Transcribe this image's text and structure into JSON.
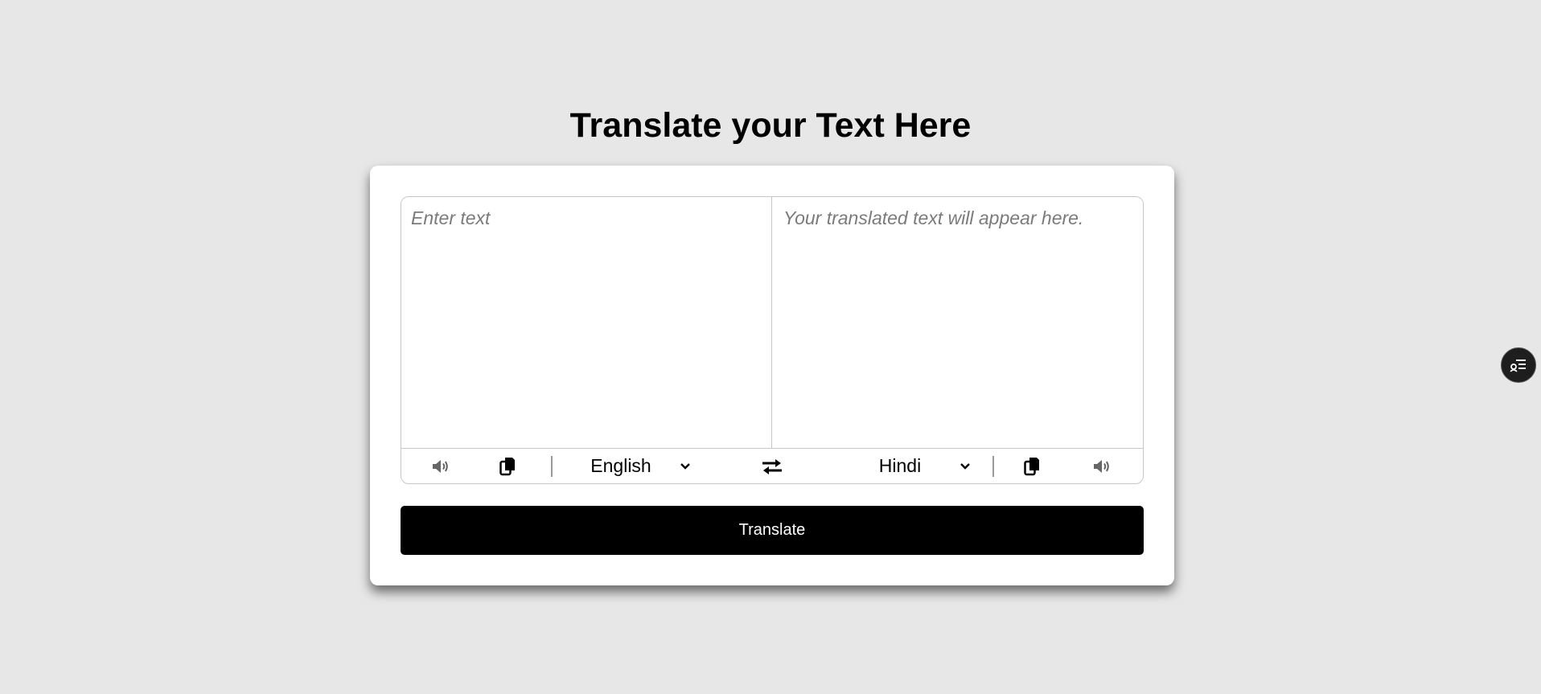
{
  "page": {
    "title": "Translate your Text Here"
  },
  "source": {
    "placeholder": "Enter text",
    "value": "",
    "language": "English",
    "speak_icon": "speaker-icon",
    "copy_icon": "copy-icon"
  },
  "target": {
    "placeholder": "Your translated text will appear here.",
    "value": "",
    "language": "Hindi",
    "speak_icon": "speaker-icon",
    "copy_icon": "copy-icon"
  },
  "controls": {
    "swap_icon": "swap-arrows-icon",
    "dropdown_icon": "chevron-down-icon"
  },
  "actions": {
    "translate_label": "Translate"
  },
  "floating_button": {
    "icon": "user-list-icon"
  },
  "colors": {
    "background": "#e7e7e7",
    "card": "#ffffff",
    "button": "#000000",
    "button_text": "#ffffff",
    "placeholder": "#7b7b7b",
    "border": "#c7c7c7"
  }
}
